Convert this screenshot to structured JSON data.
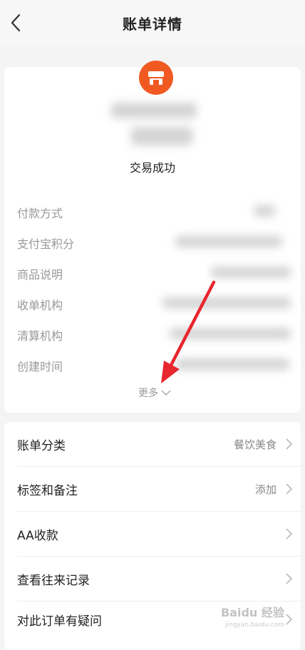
{
  "header": {
    "title": "账单详情"
  },
  "summary": {
    "status": "交易成功"
  },
  "details": {
    "items": [
      {
        "label": "付款方式"
      },
      {
        "label": "支付宝积分"
      },
      {
        "label": "商品说明"
      },
      {
        "label": "收单机构"
      },
      {
        "label": "清算机构"
      },
      {
        "label": "创建时间"
      }
    ],
    "more_label": "更多"
  },
  "actions": {
    "items": [
      {
        "label": "账单分类",
        "value": "餐饮美食"
      },
      {
        "label": "标签和备注",
        "value": "添加"
      },
      {
        "label": "AA收款",
        "value": ""
      },
      {
        "label": "查看往来记录",
        "value": ""
      },
      {
        "label": "对此订单有疑问",
        "value": ""
      }
    ]
  },
  "watermark": {
    "text": "Baidu 经验",
    "sub": "jingyan.baidu.com"
  },
  "colors": {
    "accent": "#f05a22",
    "annotation_arrow": "#e8262e"
  },
  "icons": [
    "back-icon",
    "shop-icon",
    "chevron-down-icon",
    "chevron-right-icon",
    "red-arrow-annotation"
  ]
}
